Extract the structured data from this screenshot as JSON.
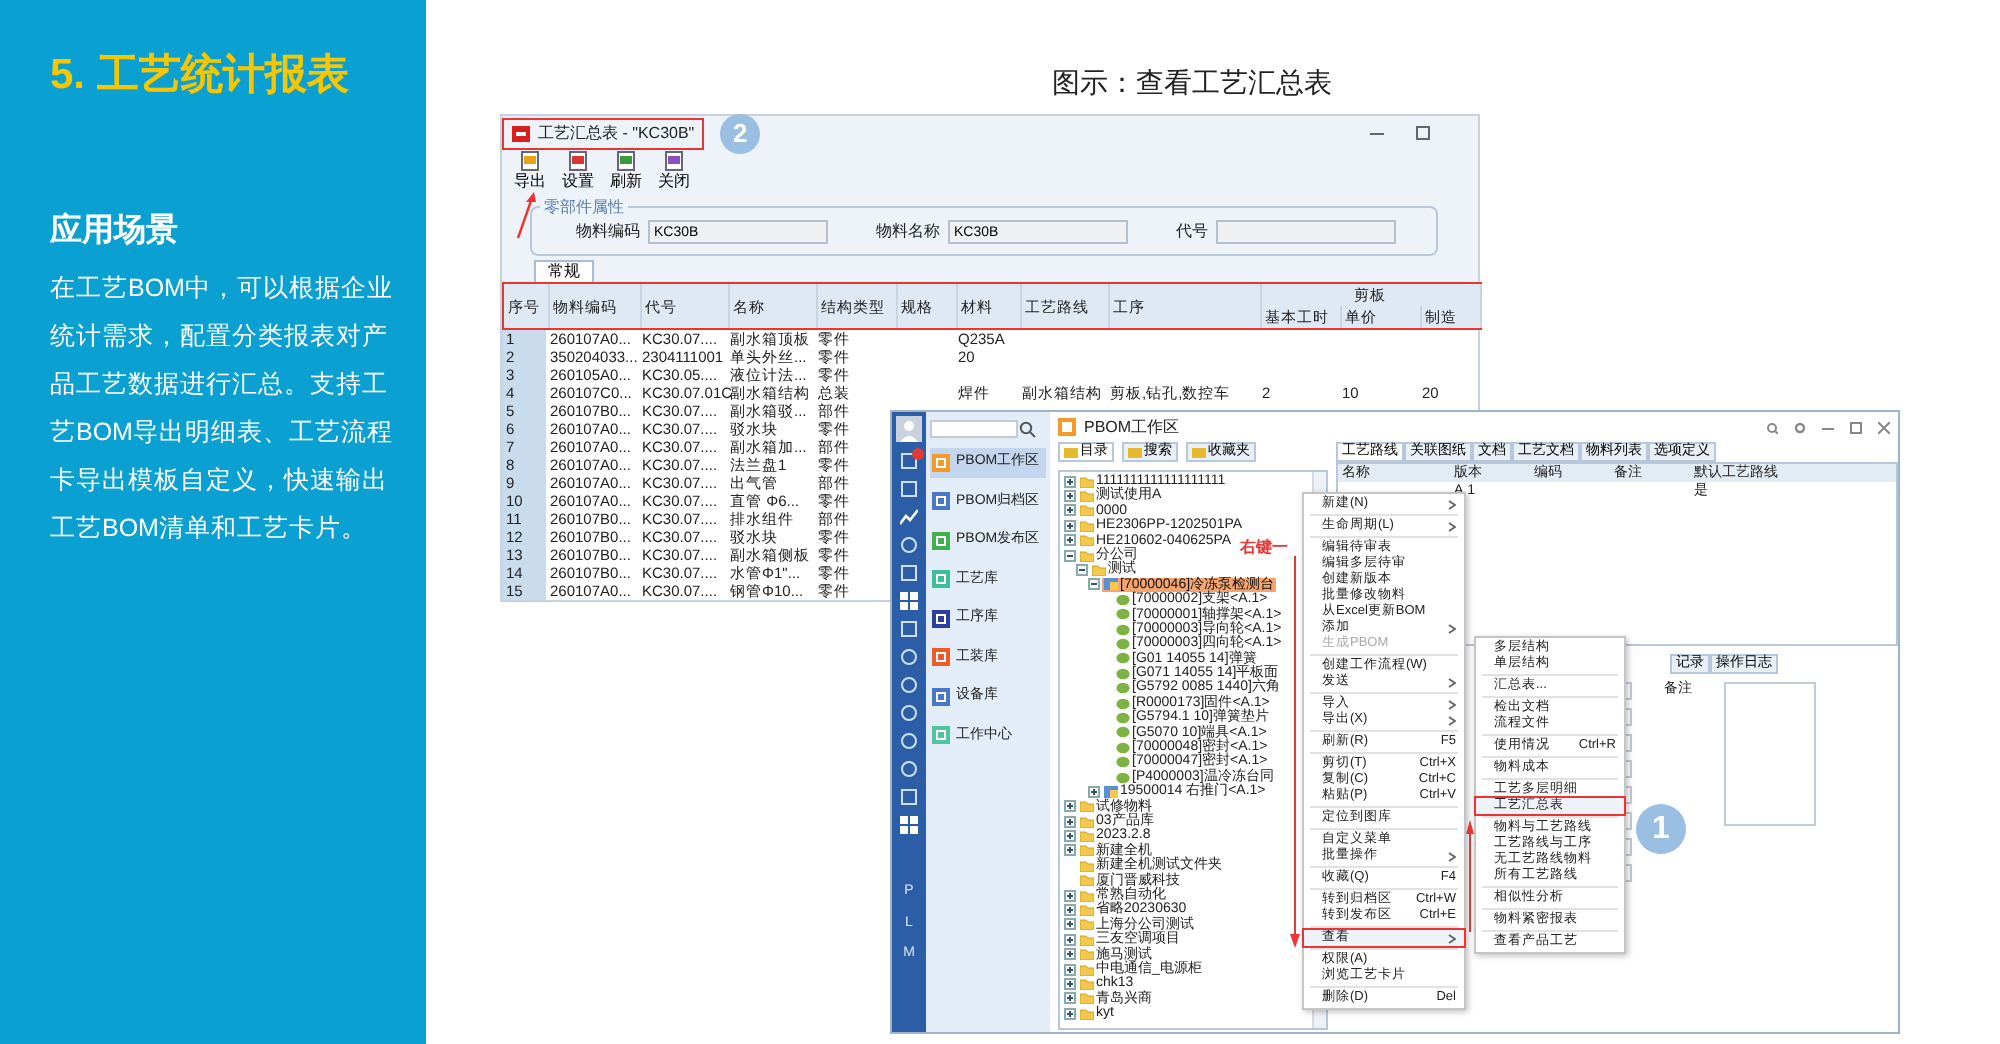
{
  "slide": {
    "title": "5. 工艺统计报表",
    "section_heading": "应用场景",
    "description": "在工艺BOM中，可以根据企业统计需求，配置分类报表对产品工艺数据进行汇总。支持工艺BOM导出明细表、工艺流程卡导出模板自定义，快速输出工艺BOM清单和工艺卡片。"
  },
  "caption": "图示：查看工艺汇总表",
  "summary_window": {
    "title": "工艺汇总表 - \"KC30B\"",
    "step_badge": "2",
    "toolbar": [
      "导出",
      "设置",
      "刷新",
      "关闭"
    ],
    "group_title": "零部件属性",
    "fields": [
      {
        "label": "物料编码",
        "value": "KC30B"
      },
      {
        "label": "物料名称",
        "value": "KC30B"
      },
      {
        "label": "代号"
      }
    ],
    "tabs": [
      {
        "label": "常规",
        "selected": true
      }
    ],
    "columns": [
      "序号",
      "物料编码",
      "代号",
      "名称",
      "结构类型",
      "规格",
      "材料",
      "工艺路线",
      "工序"
    ],
    "column_group": {
      "label": "剪板",
      "columns": [
        "基本工时",
        "单价",
        "制造"
      ]
    },
    "rows": [
      [
        "1",
        "260107A0...",
        "KC30.07....",
        "副水箱顶板",
        "零件",
        null,
        "Q235A",
        null,
        null,
        null,
        null,
        null
      ],
      [
        "2",
        "350204033...",
        "2304111001",
        "单头外丝...",
        "零件",
        null,
        "20",
        null,
        null,
        null,
        null,
        null
      ],
      [
        "3",
        "260105A0...",
        "KC30.05....",
        "液位计法...",
        "零件",
        null,
        null,
        null,
        null,
        null,
        null,
        null
      ],
      [
        "4",
        "260107C0...",
        "KC30.07.01C",
        "副水箱结构",
        "总装",
        null,
        "焊件",
        "副水箱结构",
        "剪板,钻孔,数控车",
        "2",
        "10",
        "20"
      ],
      [
        "5",
        "260107B0...",
        "KC30.07....",
        "副水箱驳...",
        "部件",
        null,
        null,
        null,
        null,
        null,
        null,
        null
      ],
      [
        "6",
        "260107A0...",
        "KC30.07....",
        "驳水块",
        "零件",
        null,
        null,
        null,
        null,
        null,
        null,
        null
      ],
      [
        "7",
        "260107A0...",
        "KC30.07....",
        "副水箱加...",
        "部件",
        null,
        null,
        null,
        null,
        null,
        null,
        null
      ],
      [
        "8",
        "260107A0...",
        "KC30.07....",
        "法兰盘1",
        "零件",
        null,
        null,
        null,
        null,
        null,
        null,
        null
      ],
      [
        "9",
        "260107A0...",
        "KC30.07....",
        "出气管",
        "部件",
        null,
        null,
        null,
        null,
        null,
        null,
        null
      ],
      [
        "10",
        "260107A0...",
        "KC30.07....",
        "直管 Φ6...",
        "零件",
        null,
        null,
        null,
        null,
        null,
        null,
        null
      ],
      [
        "11",
        "260107B0...",
        "KC30.07....",
        "排水组件",
        "部件",
        null,
        null,
        null,
        null,
        null,
        null,
        null
      ],
      [
        "12",
        "260107B0...",
        "KC30.07....",
        "驳水块",
        "零件",
        null,
        null,
        null,
        null,
        null,
        null,
        null
      ],
      [
        "13",
        "260107B0...",
        "KC30.07....",
        "副水箱侧板",
        "零件",
        null,
        null,
        null,
        null,
        null,
        null,
        null
      ],
      [
        "14",
        "260107B0...",
        "KC30.07....",
        "水管Φ1\"...",
        "零件",
        null,
        null,
        null,
        null,
        null,
        null,
        null
      ],
      [
        "15",
        "260107A0...",
        "KC30.07....",
        "钢管Φ10...",
        "零件",
        null,
        null,
        null,
        null,
        null,
        null,
        null
      ]
    ]
  },
  "workspace_window": {
    "rail_letters": [
      "P",
      "L",
      "M"
    ],
    "nav": [
      {
        "label": "PBOM工作区",
        "selected": true,
        "color": "#f39a2b"
      },
      {
        "label": "PBOM归档区",
        "selected": false,
        "color": "#4a78c8"
      },
      {
        "label": "PBOM发布区",
        "selected": false,
        "color": "#3fb04f"
      },
      {
        "label": "工艺库",
        "selected": false,
        "color": "#3bbf9a"
      },
      {
        "label": "工序库",
        "selected": false,
        "color": "#2a3f9e"
      },
      {
        "label": "工装库",
        "selected": false,
        "color": "#f05a28"
      },
      {
        "label": "设备库",
        "selected": false,
        "color": "#4a78c8"
      },
      {
        "label": "工作中心",
        "selected": false,
        "color": "#4ec6a0"
      }
    ],
    "header": "PBOM工作区",
    "tree_tabs": [
      {
        "label": "目录",
        "selected": true
      },
      {
        "label": "搜索",
        "selected": false
      },
      {
        "label": "收藏夹",
        "selected": false
      }
    ],
    "tree": [
      {
        "label": "1111111111111111111",
        "kind": "folder",
        "expanded": false,
        "selected": false
      },
      {
        "label": "测试使用A",
        "kind": "folder",
        "expanded": false,
        "selected": false
      },
      {
        "label": "0000",
        "kind": "folder",
        "expanded": false,
        "selected": false
      },
      {
        "label": "HE2306PP-1202501PA",
        "kind": "folder",
        "expanded": false,
        "selected": false
      },
      {
        "label": "HE210602-040625PA",
        "kind": "folder",
        "expanded": false,
        "selected": false
      },
      {
        "label": "分公司",
        "kind": "folder",
        "expanded": true,
        "selected": false,
        "children": [
          {
            "label": "测试",
            "kind": "folder",
            "expanded": true,
            "selected": false,
            "children": [
              {
                "label": "[70000046]冷冻泵检测台",
                "kind": "assembly",
                "expanded": true,
                "selected": true,
                "children": [
                  {
                    "label": "[70000002]支架<A.1>",
                    "kind": "part",
                    "selected": false
                  },
                  {
                    "label": "[70000001]轴撑架<A.1>",
                    "kind": "part",
                    "selected": false
                  },
                  {
                    "label": "[70000003]导向轮<A.1>",
                    "kind": "part",
                    "selected": false
                  },
                  {
                    "label": "[70000003]四向轮<A.1>",
                    "kind": "part",
                    "selected": false
                  },
                  {
                    "label": "[G01 14055 14]弹簧",
                    "kind": "part",
                    "selected": false
                  },
                  {
                    "label": "[G071 14055 14]平板面",
                    "kind": "part",
                    "selected": false
                  },
                  {
                    "label": "[G5792 0085 1440]六角",
                    "kind": "part",
                    "selected": false
                  },
                  {
                    "label": "[R0000173]固件<A.1>",
                    "kind": "part",
                    "selected": false
                  },
                  {
                    "label": "[G5794.1 10]弹簧垫片",
                    "kind": "part",
                    "selected": false
                  },
                  {
                    "label": "[G5070 10]端具<A.1>",
                    "kind": "part",
                    "selected": false
                  },
                  {
                    "label": "[70000048]密封<A.1>",
                    "kind": "part",
                    "selected": false
                  },
                  {
                    "label": "[70000047]密封<A.1>",
                    "kind": "part",
                    "selected": false
                  },
                  {
                    "label": "[P4000003]温冷冻台同",
                    "kind": "part",
                    "selected": false
                  }
                ]
              },
              {
                "label": "19500014 右推门<A.1>",
                "kind": "assembly",
                "expanded": false,
                "selected": false
              }
            ]
          }
        ]
      },
      {
        "label": "试修物料",
        "kind": "folder",
        "expanded": false,
        "selected": false
      },
      {
        "label": "03产品库",
        "kind": "folder",
        "expanded": false,
        "selected": false
      },
      {
        "label": "2023.2.8",
        "kind": "folder",
        "expanded": false,
        "selected": false
      },
      {
        "label": "新建全机",
        "kind": "folder",
        "expanded": false,
        "selected": false
      },
      {
        "label": "新建全机测试文件夹",
        "kind": "folder",
        "selected": false
      },
      {
        "label": "厦门晋威科技",
        "kind": "folder",
        "selected": false
      },
      {
        "label": "常熟自动化",
        "kind": "folder",
        "expanded": false,
        "selected": false
      },
      {
        "label": "省略20230630",
        "kind": "folder",
        "expanded": false,
        "selected": false
      },
      {
        "label": "上海分公司测试",
        "kind": "folder",
        "expanded": false,
        "selected": false
      },
      {
        "label": "三友空调项目",
        "kind": "folder",
        "expanded": false,
        "selected": false
      },
      {
        "label": "施马测试",
        "kind": "folder",
        "expanded": false,
        "selected": false
      },
      {
        "label": "中电通信_电源柜",
        "kind": "folder",
        "expanded": false,
        "selected": false
      },
      {
        "label": "chk13",
        "kind": "folder",
        "expanded": false,
        "selected": false
      },
      {
        "label": "青岛兴商",
        "kind": "folder",
        "expanded": false,
        "selected": false
      },
      {
        "label": "kyt",
        "kind": "folder",
        "expanded": false,
        "selected": false
      }
    ],
    "right_tabs": [
      {
        "label": "工艺路线",
        "selected": true
      },
      {
        "label": "关联图纸",
        "selected": false
      },
      {
        "label": "文档",
        "selected": false
      },
      {
        "label": "工艺文档",
        "selected": false
      },
      {
        "label": "物料列表",
        "selected": false
      },
      {
        "label": "选项定义",
        "selected": false
      }
    ],
    "right_columns": [
      "名称",
      "版本",
      "编码",
      "备注",
      "默认工艺路线"
    ],
    "right_rows": [
      [
        null,
        "A.1",
        null,
        null,
        "是"
      ]
    ],
    "lower_tabs": [
      {
        "label": "记录",
        "selected": false
      },
      {
        "label": "操作日志",
        "selected": false
      }
    ],
    "note_label": "备注",
    "annotation": "右键一",
    "step_badge": "1",
    "context_menu": [
      {
        "label": "新建(N)",
        "submenu": true,
        "disabled": false,
        "selected": false
      },
      {
        "kind": "separator"
      },
      {
        "label": "生命周期(L)",
        "submenu": true,
        "disabled": false,
        "selected": false
      },
      {
        "kind": "separator"
      },
      {
        "label": "编辑待审表",
        "submenu": false,
        "disabled": false,
        "selected": false
      },
      {
        "label": "编辑多层待审",
        "submenu": false,
        "disabled": false,
        "selected": false
      },
      {
        "label": "创建新版本",
        "submenu": false,
        "disabled": false,
        "selected": false
      },
      {
        "label": "批量修改物料",
        "submenu": false,
        "disabled": false,
        "selected": false
      },
      {
        "label": "从Excel更新BOM",
        "submenu": false,
        "disabled": false,
        "selected": false
      },
      {
        "label": "添加",
        "submenu": true,
        "disabled": false,
        "selected": false
      },
      {
        "label": "生成PBOM",
        "submenu": false,
        "disabled": true,
        "selected": false
      },
      {
        "kind": "separator"
      },
      {
        "label": "创建工作流程(W)",
        "submenu": false,
        "disabled": false,
        "selected": false
      },
      {
        "label": "发送",
        "submenu": true,
        "disabled": false,
        "selected": false
      },
      {
        "kind": "separator"
      },
      {
        "label": "导入",
        "submenu": true,
        "disabled": false,
        "selected": false
      },
      {
        "label": "导出(X)",
        "submenu": true,
        "disabled": false,
        "selected": false
      },
      {
        "kind": "separator"
      },
      {
        "label": "刷新(R)",
        "shortcut": "F5",
        "submenu": false,
        "disabled": false,
        "selected": false
      },
      {
        "kind": "separator"
      },
      {
        "label": "剪切(T)",
        "shortcut": "Ctrl+X",
        "submenu": false,
        "disabled": false,
        "selected": false
      },
      {
        "label": "复制(C)",
        "shortcut": "Ctrl+C",
        "submenu": false,
        "disabled": false,
        "selected": false
      },
      {
        "label": "粘贴(P)",
        "shortcut": "Ctrl+V",
        "submenu": false,
        "disabled": false,
        "selected": false
      },
      {
        "kind": "separator"
      },
      {
        "label": "定位到图库",
        "submenu": false,
        "disabled": false,
        "selected": false
      },
      {
        "kind": "separator"
      },
      {
        "label": "自定义菜单",
        "submenu": false,
        "disabled": false,
        "selected": false
      },
      {
        "label": "批量操作",
        "submenu": true,
        "disabled": false,
        "selected": false
      },
      {
        "kind": "separator"
      },
      {
        "label": "收藏(Q)",
        "shortcut": "F4",
        "submenu": false,
        "disabled": false,
        "selected": false
      },
      {
        "kind": "separator"
      },
      {
        "label": "转到归档区",
        "shortcut": "Ctrl+W",
        "submenu": false,
        "disabled": false,
        "selected": false
      },
      {
        "label": "转到发布区",
        "shortcut": "Ctrl+E",
        "submenu": false,
        "disabled": false,
        "selected": false
      },
      {
        "kind": "separator"
      },
      {
        "label": "查看",
        "submenu": true,
        "disabled": false,
        "selected": true
      },
      {
        "kind": "separator"
      },
      {
        "label": "权限(A)",
        "submenu": false,
        "disabled": false,
        "selected": false
      },
      {
        "label": "浏览工艺卡片",
        "submenu": false,
        "disabled": false,
        "selected": false
      },
      {
        "kind": "separator"
      },
      {
        "label": "删除(D)",
        "shortcut": "Del",
        "submenu": false,
        "disabled": false,
        "selected": false
      }
    ],
    "submenu": [
      {
        "label": "多层结构",
        "selected": false
      },
      {
        "label": "单层结构",
        "selected": false
      },
      {
        "kind": "separator"
      },
      {
        "label": "汇总表...",
        "selected": false
      },
      {
        "kind": "separator"
      },
      {
        "label": "检出文档",
        "selected": false
      },
      {
        "label": "流程文件",
        "selected": false
      },
      {
        "kind": "separator"
      },
      {
        "label": "使用情况",
        "shortcut": "Ctrl+R",
        "selected": false
      },
      {
        "kind": "separator"
      },
      {
        "label": "物料成本",
        "selected": false
      },
      {
        "kind": "separator"
      },
      {
        "label": "工艺多层明细",
        "selected": false
      },
      {
        "label": "工艺汇总表",
        "selected": true
      },
      {
        "kind": "separator"
      },
      {
        "label": "物料与工艺路线",
        "selected": false
      },
      {
        "label": "工艺路线与工序",
        "selected": false
      },
      {
        "label": "无工艺路线物料",
        "selected": false
      },
      {
        "label": "所有工艺路线",
        "selected": false
      },
      {
        "kind": "separator"
      },
      {
        "label": "相似性分析",
        "selected": false
      },
      {
        "kind": "separator"
      },
      {
        "label": "物料紧密报表",
        "selected": false
      },
      {
        "kind": "separator"
      },
      {
        "label": "查看产品工艺",
        "selected": false
      }
    ]
  }
}
